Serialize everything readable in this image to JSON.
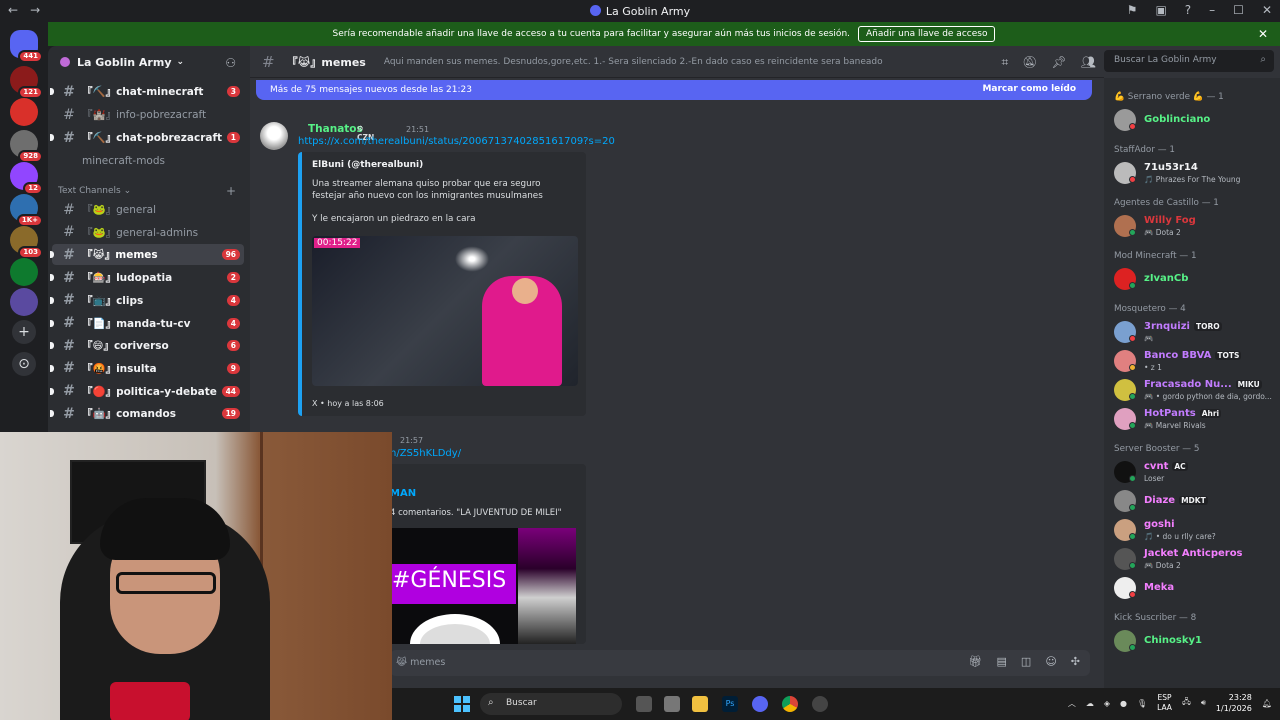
{
  "window": {
    "title": "La Goblin Army"
  },
  "notice": {
    "text": "Sería recomendable añadir una llave de acceso a tu cuenta para facilitar y asegurar aún más tus inicios de sesión.",
    "button": "Añadir una llave de acceso"
  },
  "rail": {
    "servers": [
      {
        "badge": "441",
        "color": "#5865f2"
      },
      {
        "badge": "121",
        "color": "#8b1b1b"
      },
      {
        "badge": "",
        "color": "#d9302a"
      },
      {
        "badge": "928",
        "color": "#6e6e6e"
      },
      {
        "badge": "12",
        "color": "#9146ff"
      },
      {
        "badge": "1K+",
        "color": "#2e6fb0"
      },
      {
        "badge": "103",
        "color": "#8a6a2a"
      },
      {
        "badge": "",
        "color": "#0e7a2e"
      },
      {
        "badge": "",
        "color": "#5a4aa0"
      }
    ]
  },
  "sidebar": {
    "server_name": "La Goblin Army",
    "category": "Text Channels",
    "channels_top": [
      {
        "label": "『⛏️』chat-minecraft",
        "count": "3"
      },
      {
        "label": "『🏰』info-pobrezacraft",
        "count": ""
      },
      {
        "label": "『⛏️』chat-pobrezacraft",
        "count": "1"
      },
      {
        "label": "minecraft-mods",
        "count": ""
      }
    ],
    "channels": [
      {
        "label": "『🐸』general",
        "count": ""
      },
      {
        "label": "『🐸』general-admins",
        "count": ""
      },
      {
        "label": "『😹』memes",
        "count": "96"
      },
      {
        "label": "『🎰』ludopatia",
        "count": "2"
      },
      {
        "label": "『📺』clips",
        "count": "4"
      },
      {
        "label": "『📄』manda-tu-cv",
        "count": "4"
      },
      {
        "label": "『😄』coriverso",
        "count": "6"
      },
      {
        "label": "『🤬』insulta",
        "count": "9"
      },
      {
        "label": "『🔴』politica-y-debate",
        "count": "44"
      },
      {
        "label": "『🤖』comandos",
        "count": "19"
      }
    ]
  },
  "header": {
    "channel": "『😹』memes",
    "topic": "Aqui manden sus memes. Desnudos,gore,etc. 1.- Sera silenciado 2.-En dado caso es reincidente sera baneado",
    "search_placeholder": "Buscar La Goblin Army"
  },
  "chat": {
    "new_messages": "Más de 75 mensajes nuevos desde las 21:23",
    "mark_read": "Marcar como leído",
    "msg1": {
      "author": "Thanatos",
      "tag": "CZN",
      "time": "21:51",
      "link": "https://x.com/therealbuni/status/2006713740285161709?s=20",
      "embed_author": "ElBuni (@therealbuni)",
      "embed_text": "Una streamer alemana quiso probar que era seguro festejar año nuevo con los inmigrantes musulmanes",
      "embed_text2": "Y le encajaron un piedrazo en la cara",
      "image_timestamp": "00:15:22",
      "footer": "X • hoy a las 8:06"
    },
    "msg2": {
      "time": "21:57",
      "link": "n/ZS5hKLDdy/",
      "embed_author": "MAN",
      "embed_text": "4 comentarios. \"LA JUVENTUD DE MILEI\"",
      "image_text": "#GÉNESIS"
    },
    "composer_placeholder": "memes"
  },
  "members": [
    {
      "type": "cat",
      "label": "💪 Serrano verde 💪 — 1"
    },
    {
      "type": "mem",
      "name": "Goblinciano",
      "sub": "",
      "tag": "",
      "color": "#57f287",
      "av": "#9a9a9a",
      "status": "#f23f43"
    },
    {
      "type": "cat",
      "label": "StaffAdor — 1"
    },
    {
      "type": "mem",
      "name": "71u53r14",
      "sub": "🎵 Phrazes For The Young",
      "tag": "",
      "color": "#f2f3f5",
      "av": "#bbbbbb",
      "status": "#f23f43"
    },
    {
      "type": "cat",
      "label": "Agentes de Castillo — 1"
    },
    {
      "type": "mem",
      "name": "Willy Fog",
      "sub": "🎮 Dota 2",
      "tag": "",
      "color": "#da373c",
      "av": "#b07050",
      "status": "#23a55a"
    },
    {
      "type": "cat",
      "label": "Mod Minecraft — 1"
    },
    {
      "type": "mem",
      "name": "zIvanCb",
      "sub": "",
      "tag": "",
      "color": "#57f287",
      "av": "#d22",
      "status": "#23a55a"
    },
    {
      "type": "cat",
      "label": "Mosquetero — 4"
    },
    {
      "type": "mem",
      "name": "3rnquizi",
      "sub": "🎮",
      "tag": "TORO",
      "color": "#c27cff",
      "av": "#7aa0d0",
      "status": "#f23f43"
    },
    {
      "type": "mem",
      "name": "Banco BBVA",
      "sub": "• z 1",
      "tag": "TOTS",
      "color": "#c27cff",
      "av": "#e08080",
      "status": "#f0b232"
    },
    {
      "type": "mem",
      "name": "Fracasado Nu...",
      "sub": "🎮 • gordo python de dia, gordo...",
      "tag": "MIKU",
      "color": "#c27cff",
      "av": "#d0c040",
      "status": "#23a55a"
    },
    {
      "type": "mem",
      "name": "HotPants",
      "sub": "🎮 Marvel Rivals",
      "tag": "Ahri",
      "color": "#c27cff",
      "av": "#e0a0c0",
      "status": "#23a55a"
    },
    {
      "type": "cat",
      "label": "Server Booster — 5"
    },
    {
      "type": "mem",
      "name": "cvnt",
      "sub": "Loser",
      "tag": "AC",
      "color": "#f47fff",
      "av": "#111111",
      "status": "#23a55a"
    },
    {
      "type": "mem",
      "name": "Diaze",
      "sub": "",
      "tag": "MDKT",
      "color": "#f47fff",
      "av": "#888888",
      "status": "#23a55a"
    },
    {
      "type": "mem",
      "name": "goshi",
      "sub": "🎵 • do u rlly care?",
      "tag": "",
      "color": "#f47fff",
      "av": "#caa080",
      "status": "#23a55a"
    },
    {
      "type": "mem",
      "name": "Jacket Anticperos",
      "sub": "🎮 Dota 2",
      "tag": "",
      "color": "#f47fff",
      "av": "#555555",
      "status": "#23a55a"
    },
    {
      "type": "mem",
      "name": "Meka",
      "sub": "",
      "tag": "",
      "color": "#f47fff",
      "av": "#eeeeee",
      "status": "#f23f43"
    },
    {
      "type": "cat",
      "label": "Kick Suscriber — 8"
    },
    {
      "type": "mem",
      "name": "Chinosky1",
      "sub": "",
      "tag": "",
      "color": "#57f287",
      "av": "#6a8a5a",
      "status": "#23a55a"
    }
  ],
  "taskbar": {
    "search": "Buscar",
    "lang1": "ESP",
    "lang2": "LAA",
    "time": "23:28",
    "date": "1/1/2026"
  }
}
